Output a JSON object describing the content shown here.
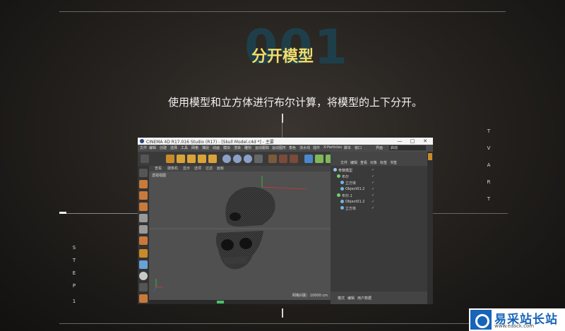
{
  "page": {
    "step_number": "001",
    "title": "分开模型",
    "description": "使用模型和立方体进行布尔计算，将模型的上下分开。",
    "vertical_right": [
      "T",
      "V",
      "A",
      "R",
      "T"
    ],
    "vertical_left": [
      "S",
      "T",
      "E",
      "P",
      "1"
    ],
    "logo_cn": "易采站长站",
    "logo_en": "www.easck.com"
  },
  "app": {
    "title": "CINEMA 4D R17.016 Studio (R17) - [Skull Model.c4d *] - 主要",
    "window_controls": [
      "—",
      "□",
      "✕"
    ],
    "menu": [
      "文件",
      "编辑",
      "创建",
      "选择",
      "工具",
      "网格",
      "捕捉",
      "动画",
      "模拟",
      "渲染",
      "雕刻",
      "运动跟踪",
      "运动图形",
      "角色",
      "流水线",
      "插件",
      "X-Particles",
      "脚本",
      "窗口"
    ],
    "menu_right": "界面",
    "menu_right_value": "启动",
    "viewport_menu": [
      "查看",
      "摄像机",
      "显示",
      "选项",
      "过滤",
      "面板"
    ],
    "viewport_label": "透视视图",
    "grid_info": "网格间距：10000 cm",
    "object_tabs": [
      "文件",
      "编辑",
      "查看",
      "对象",
      "标签",
      "书签"
    ],
    "objects": [
      {
        "name": "骨骼模型",
        "indent": 0,
        "color": "#9ac3e8"
      },
      {
        "name": "布尔",
        "indent": 1,
        "color": "#6fd06f"
      },
      {
        "name": "立方体",
        "indent": 2,
        "color": "#6fb7e8"
      },
      {
        "name": "Object01.2",
        "indent": 2,
        "color": "#6fb7e8"
      },
      {
        "name": "布尔.1",
        "indent": 1,
        "color": "#6fd06f"
      },
      {
        "name": "Object01.2",
        "indent": 2,
        "color": "#6fb7e8"
      },
      {
        "name": "立方体",
        "indent": 2,
        "color": "#6fb7e8"
      }
    ],
    "attr_tabs": [
      "模式",
      "编辑",
      "用户数据"
    ]
  },
  "colors": {
    "title_yellow": "#f2dc6b",
    "big_number": "#1e3f4a",
    "logo_blue": "#1864b8"
  }
}
